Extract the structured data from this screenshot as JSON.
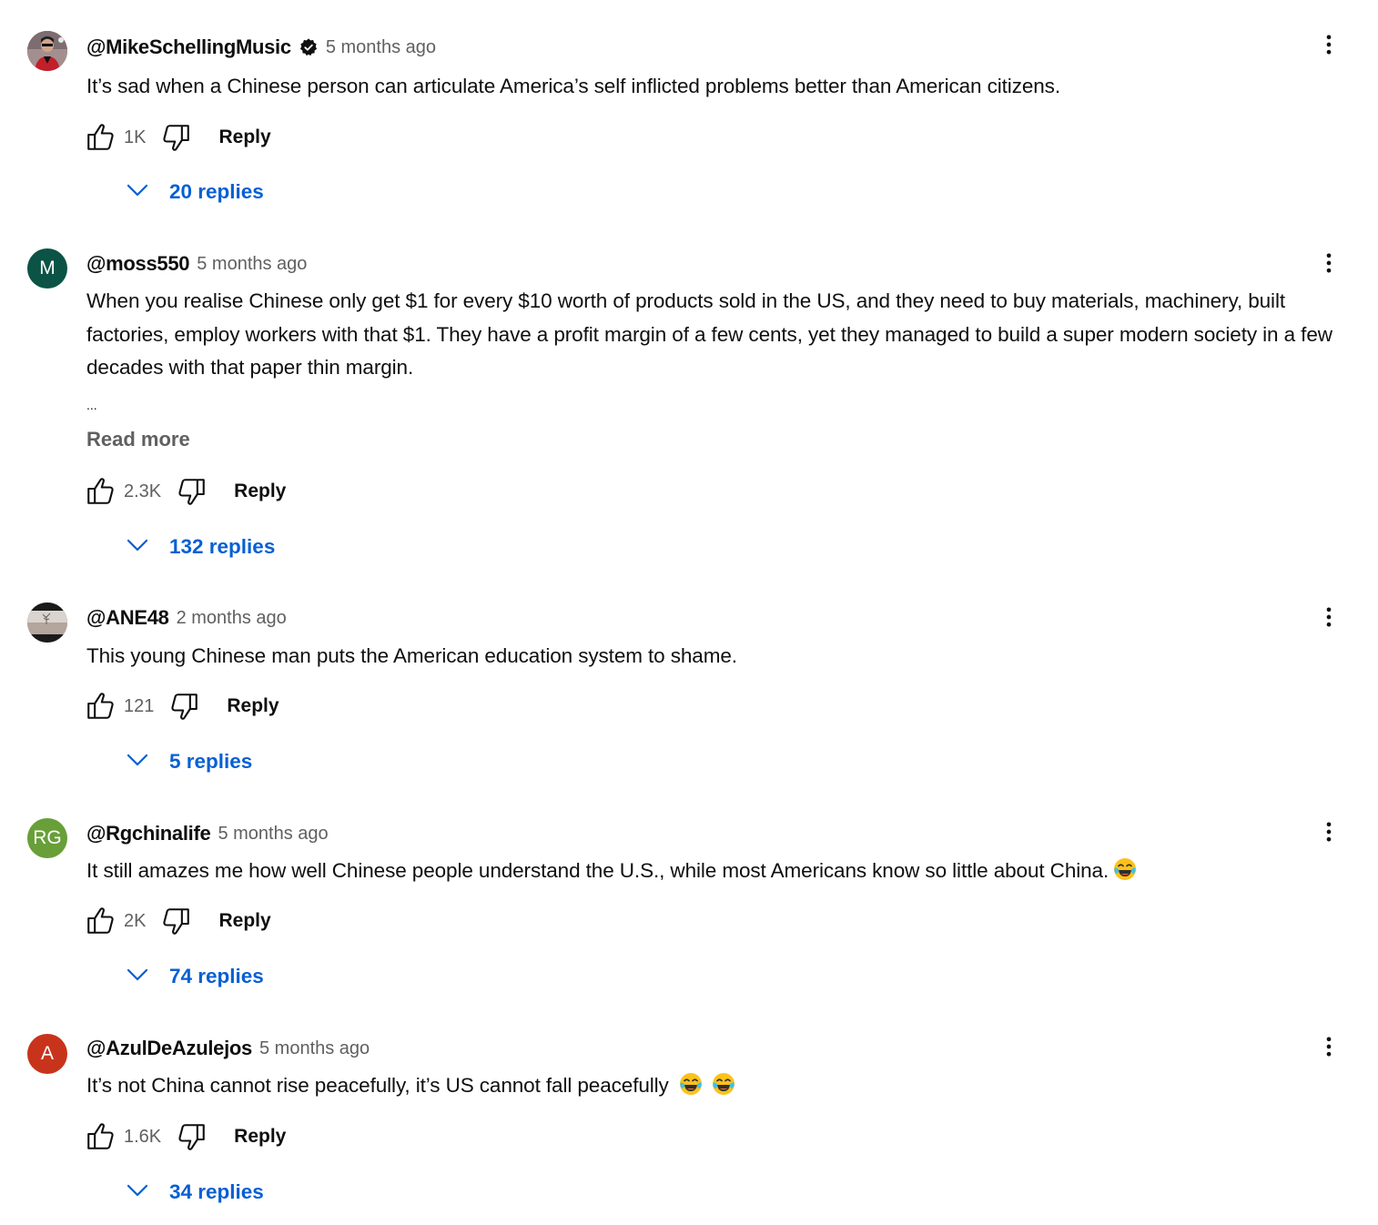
{
  "comments": [
    {
      "author": "@MikeSchellingMusic",
      "verified": true,
      "time": "5 months ago",
      "text": "It’s sad when a Chinese person can articulate America’s self inflicted problems better than American citizens.",
      "likes": "1K",
      "reply_label": "Reply",
      "replies": "20 replies",
      "avatar": {
        "type": "photo",
        "icon": "person-photo"
      }
    },
    {
      "author": "@moss550",
      "verified": false,
      "time": "5 months ago",
      "text": "When you realise Chinese only get $1 for every $10 worth of products sold in the US, and they need to buy materials, machinery, built factories, employ workers with that $1. They have a profit margin of a few cents, yet they managed to build a super modern society in a few decades with that paper thin margin.",
      "ellipsis": "...",
      "read_more": "Read more",
      "likes": "2.3K",
      "reply_label": "Reply",
      "replies": "132 replies",
      "avatar": {
        "type": "letter",
        "letter": "M",
        "color": "#0b5345"
      }
    },
    {
      "author": "@ANE48",
      "verified": false,
      "time": "2 months ago",
      "text": "This young Chinese man puts the American education system to shame.",
      "likes": "121",
      "reply_label": "Reply",
      "replies": "5 replies",
      "avatar": {
        "type": "photo",
        "icon": "landscape-photo"
      }
    },
    {
      "author": "@Rgchinalife",
      "verified": false,
      "time": "5 months ago",
      "text": "It still amazes me how well Chinese people understand the U.S., while most Americans know so little about China.",
      "emoji_count": 1,
      "likes": "2K",
      "reply_label": "Reply",
      "replies": "74 replies",
      "avatar": {
        "type": "letter",
        "letter": "RG",
        "color": "#689f38"
      }
    },
    {
      "author": "@AzulDeAzulejos",
      "verified": false,
      "time": "5 months ago",
      "text": "It’s not China cannot rise peacefully, it’s US cannot fall peacefully ",
      "emoji_count": 2,
      "likes": "1.6K",
      "reply_label": "Reply",
      "replies": "34 replies",
      "avatar": {
        "type": "letter",
        "letter": "A",
        "color": "#c2410c"
      }
    }
  ],
  "colors": {
    "link": "#065fd4",
    "secondary_text": "#606060",
    "primary_text": "#0f0f0f"
  },
  "icons": [
    "like-icon",
    "dislike-icon",
    "more-vert-icon",
    "chevron-down-icon",
    "verified-icon",
    "tears-of-joy-emoji"
  ]
}
